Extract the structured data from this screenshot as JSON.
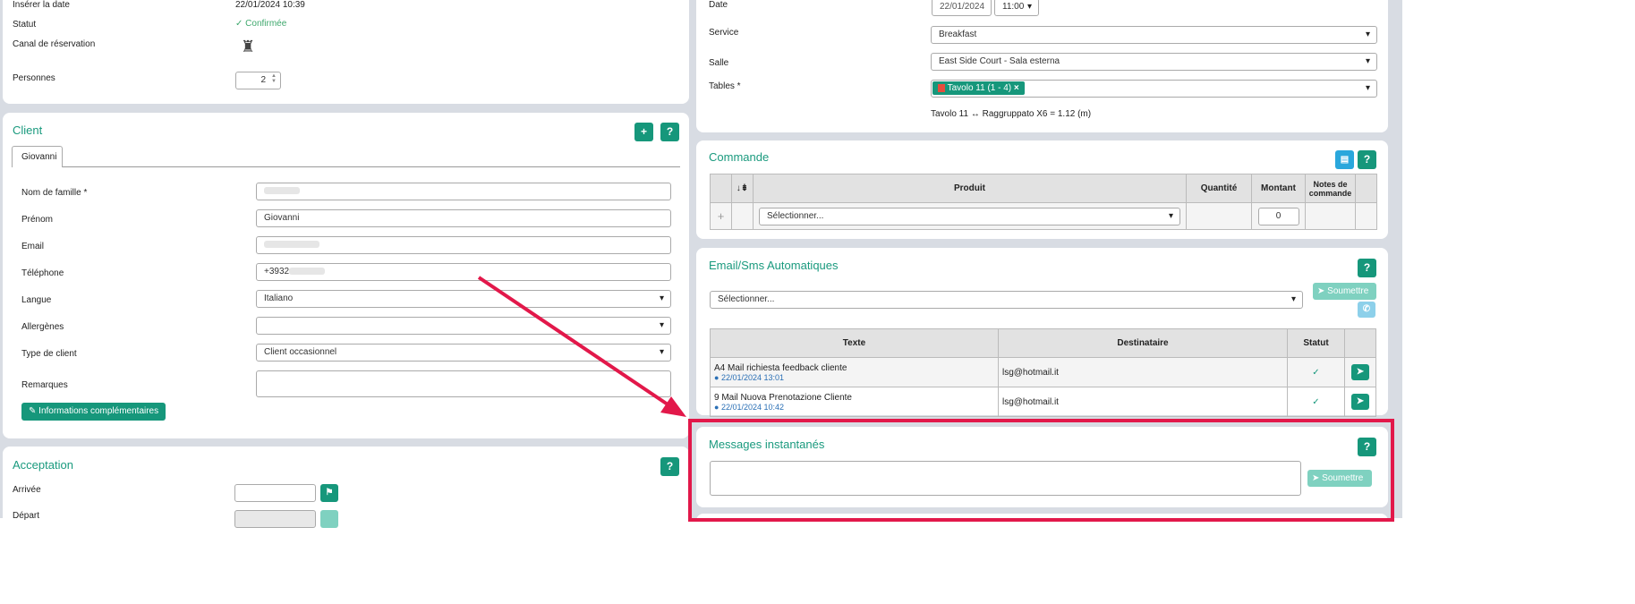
{
  "reservation": {
    "insert_date_label": "Insérer la date",
    "insert_date_value": "22/01/2024 10:39",
    "status_label": "Statut",
    "status_value": "✓ Confirmée",
    "channel_label": "Canal de réservation",
    "persons_label": "Personnes",
    "persons_value": "2"
  },
  "client": {
    "title": "Client",
    "add": "+",
    "help": "?",
    "tab": "Giovanni",
    "fields": {
      "lastname": "Nom de famille *",
      "firstname": "Prénom",
      "firstname_value": "Giovanni",
      "email": "Email",
      "phone": "Téléphone",
      "phone_value": "+3932",
      "language": "Langue",
      "language_value": "Italiano",
      "allergens": "Allergènes",
      "client_type": "Type de client",
      "client_type_value": "Client occasionnel",
      "remarks": "Remarques"
    },
    "more_info": "Informations complémentaires"
  },
  "acceptance": {
    "title": "Acceptation",
    "help": "?",
    "arrival": "Arrivée",
    "departure": "Départ"
  },
  "booking": {
    "date_label": "Date",
    "date_value": "22/01/2024",
    "time_value": "11:00",
    "service_label": "Service",
    "service_value": "Breakfast",
    "room_label": "Salle",
    "room_value": "East Side Court - Sala esterna",
    "tables_label": "Tables *",
    "table_tag": "Tavolo 11 (1 - 4)",
    "table_info": "Tavolo 11 ↔ Raggruppato X6 = 1.12 (m)"
  },
  "order": {
    "title": "Commande",
    "help": "?",
    "columns": [
      "",
      "↓⇟",
      "Produit",
      "Quantité",
      "Montant",
      "Notes de commande",
      ""
    ],
    "add": "+",
    "product_placeholder": "Sélectionner...",
    "amount": "0"
  },
  "auto_msgs": {
    "title": "Email/Sms Automatiques",
    "help": "?",
    "select_placeholder": "Sélectionner...",
    "submit": "Soumettre",
    "columns": [
      "Texte",
      "Destinataire",
      "Statut",
      ""
    ],
    "rows": [
      {
        "text": "A4 Mail richiesta feedback cliente",
        "date": "22/01/2024 13:01",
        "recipient": "lsg@hotmail.it",
        "status": "✓"
      },
      {
        "text": "9 Mail Nuova Prenotazione Cliente",
        "date": "22/01/2024 10:42",
        "recipient": "lsg@hotmail.it",
        "status": "✓"
      }
    ]
  },
  "instant": {
    "title": "Messages instantanés",
    "help": "?",
    "submit": "Soumettre"
  }
}
